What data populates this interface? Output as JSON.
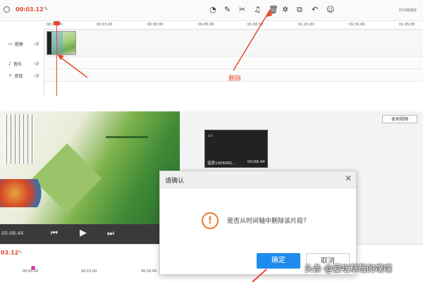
{
  "top": {
    "time": "00:03.12",
    "toolbar": [
      "undo-timer",
      "pen",
      "scissors",
      "bell",
      "trash",
      "circle-refresh",
      "crop",
      "undo",
      "smile"
    ],
    "right_hint": "时间轴缩放",
    "ruler": [
      "00:00.00",
      "00:15.00",
      "00:30.00",
      "00:45.00",
      "01:00.00",
      "01:15.00",
      "01:30.00",
      "01:45.00"
    ]
  },
  "tracks": {
    "video": "视频",
    "music": "音乐",
    "sfx": "音效"
  },
  "annotation": {
    "delete_label": "删除"
  },
  "preview": {
    "time": "00:08.44",
    "local_video": "本地视频"
  },
  "clip": {
    "name": "温度1906061...",
    "duration": "00:08.44"
  },
  "dialog": {
    "title": "请确认",
    "message": "是否从时间轴中删除该片段？",
    "confirm": "确定",
    "cancel": "取消"
  },
  "bottom": {
    "time": "03.12",
    "ruler": [
      "00:00.00",
      "00:15.00",
      "00:30.00"
    ]
  },
  "watermark": "头条 @爱吃草莓的噗噗",
  "colors": {
    "accent_red": "#e8472f",
    "confirm_blue": "#1f8ced",
    "warn_orange": "#e97a28"
  }
}
